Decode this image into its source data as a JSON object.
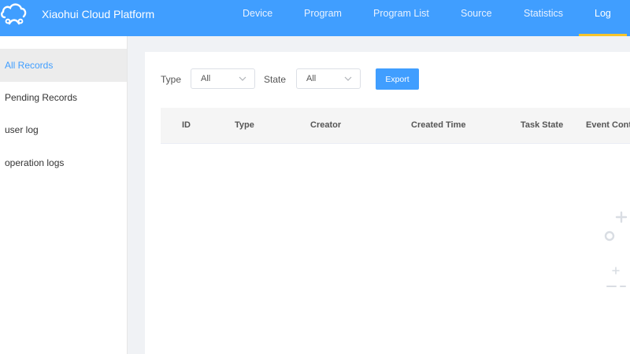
{
  "app": {
    "title": "Xiaohui Cloud Platform",
    "logo_icon": "cloud-logo-icon"
  },
  "colors": {
    "primary": "#409eff",
    "active_underline": "#f7c52b"
  },
  "nav": {
    "items": [
      {
        "label": "Device",
        "active": false
      },
      {
        "label": "Program",
        "active": false
      },
      {
        "label": "Program List",
        "active": false
      },
      {
        "label": "Source",
        "active": false
      },
      {
        "label": "Statistics",
        "active": false
      },
      {
        "label": "Log",
        "active": true
      }
    ]
  },
  "sidebar": {
    "items": [
      {
        "label": "All Records",
        "active": true
      },
      {
        "label": "Pending Records",
        "active": false
      },
      {
        "label": "user log",
        "active": false
      },
      {
        "label": "operation logs",
        "active": false
      }
    ]
  },
  "filters": {
    "type_label": "Type",
    "type_value": "All",
    "state_label": "State",
    "state_value": "All",
    "export_label": "Export"
  },
  "table": {
    "columns": [
      "ID",
      "Type",
      "Creator",
      "Created Time",
      "Task State",
      "Event Cont"
    ],
    "rows": []
  }
}
